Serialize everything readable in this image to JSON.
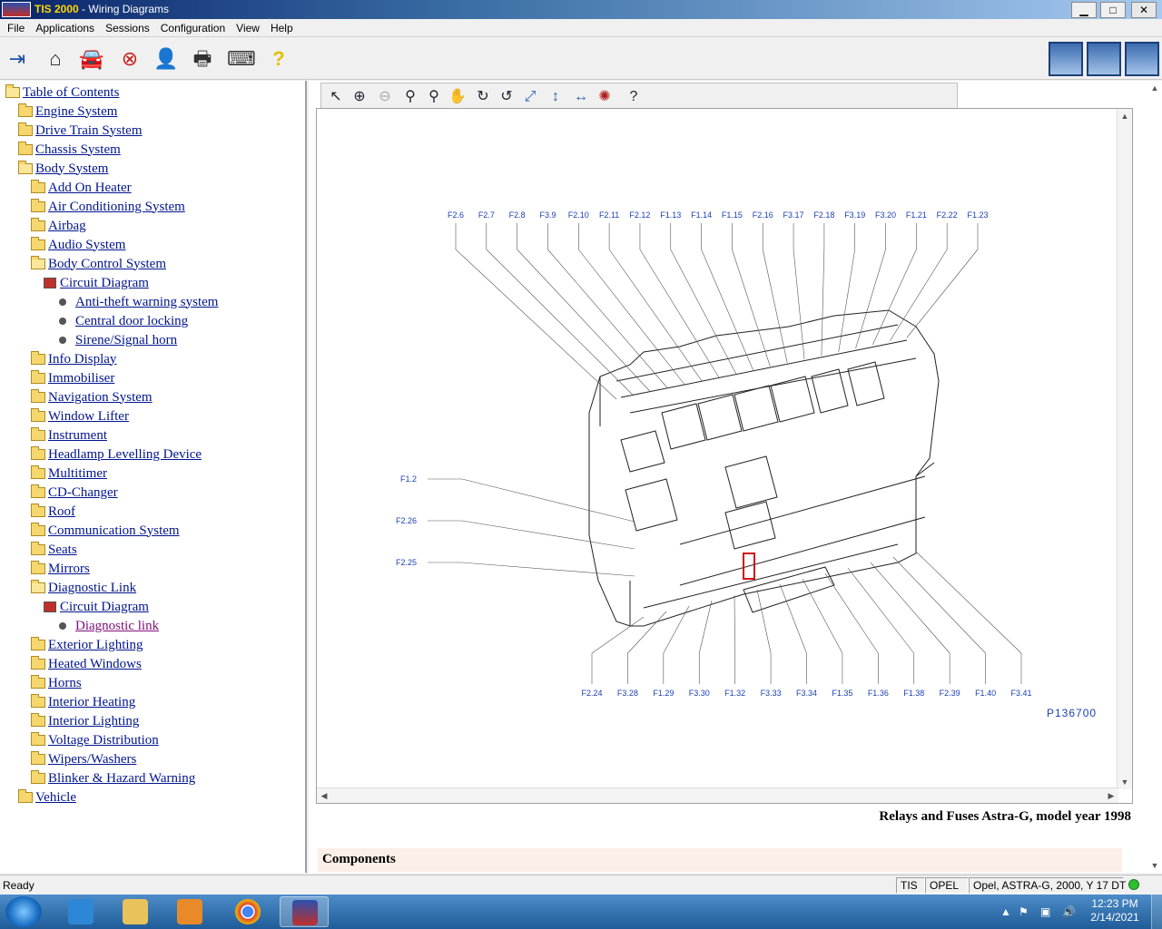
{
  "window": {
    "brand": "TIS 2000",
    "title_suffix": " - Wiring Diagrams",
    "minimize": "▁",
    "maximize": "□",
    "close": "✕"
  },
  "menu": [
    "File",
    "Applications",
    "Sessions",
    "Configuration",
    "View",
    "Help"
  ],
  "toolbar_icons": [
    "exit-icon",
    "home-icon",
    "vehicle-icon",
    "stop-icon",
    "user-icon",
    "print-icon",
    "keyboard-icon",
    "help-icon"
  ],
  "tree": [
    {
      "label": "Table of Contents",
      "depth": 0,
      "icon": "folder-open",
      "visited": false
    },
    {
      "label": "Engine System",
      "depth": 1,
      "icon": "folder",
      "visited": false
    },
    {
      "label": "Drive Train System",
      "depth": 1,
      "icon": "folder",
      "visited": false
    },
    {
      "label": "Chassis System",
      "depth": 1,
      "icon": "folder",
      "visited": false
    },
    {
      "label": "Body System",
      "depth": 1,
      "icon": "folder-open",
      "visited": false
    },
    {
      "label": "Add On Heater",
      "depth": 2,
      "icon": "folder",
      "visited": false
    },
    {
      "label": "Air Conditioning System",
      "depth": 2,
      "icon": "folder",
      "visited": false
    },
    {
      "label": "Airbag",
      "depth": 2,
      "icon": "folder",
      "visited": false
    },
    {
      "label": "Audio System",
      "depth": 2,
      "icon": "folder",
      "visited": false
    },
    {
      "label": "Body Control System",
      "depth": 2,
      "icon": "folder-open",
      "visited": false
    },
    {
      "label": "Circuit Diagram",
      "depth": 3,
      "icon": "diagram",
      "visited": false
    },
    {
      "label": "Anti-theft warning system",
      "depth": 4,
      "icon": "bullet",
      "visited": false
    },
    {
      "label": "Central door locking",
      "depth": 4,
      "icon": "bullet",
      "visited": false
    },
    {
      "label": "Sirene/Signal horn",
      "depth": 4,
      "icon": "bullet",
      "visited": false
    },
    {
      "label": "Info Display",
      "depth": 2,
      "icon": "folder",
      "visited": false
    },
    {
      "label": "Immobiliser",
      "depth": 2,
      "icon": "folder",
      "visited": false
    },
    {
      "label": "Navigation System",
      "depth": 2,
      "icon": "folder",
      "visited": false
    },
    {
      "label": "Window Lifter",
      "depth": 2,
      "icon": "folder",
      "visited": false
    },
    {
      "label": "Instrument",
      "depth": 2,
      "icon": "folder",
      "visited": false
    },
    {
      "label": "Headlamp Levelling Device",
      "depth": 2,
      "icon": "folder",
      "visited": false
    },
    {
      "label": "Multitimer",
      "depth": 2,
      "icon": "folder",
      "visited": false
    },
    {
      "label": "CD-Changer",
      "depth": 2,
      "icon": "folder",
      "visited": false
    },
    {
      "label": "Roof",
      "depth": 2,
      "icon": "folder",
      "visited": false
    },
    {
      "label": "Communication System",
      "depth": 2,
      "icon": "folder",
      "visited": false
    },
    {
      "label": "Seats",
      "depth": 2,
      "icon": "folder",
      "visited": false
    },
    {
      "label": "Mirrors",
      "depth": 2,
      "icon": "folder",
      "visited": false
    },
    {
      "label": "Diagnostic Link",
      "depth": 2,
      "icon": "folder-open",
      "visited": false
    },
    {
      "label": "Circuit Diagram",
      "depth": 3,
      "icon": "diagram",
      "visited": false
    },
    {
      "label": "Diagnostic link",
      "depth": 4,
      "icon": "bullet",
      "visited": true
    },
    {
      "label": "Exterior Lighting",
      "depth": 2,
      "icon": "folder",
      "visited": false
    },
    {
      "label": "Heated Windows",
      "depth": 2,
      "icon": "folder",
      "visited": false
    },
    {
      "label": "Horns",
      "depth": 2,
      "icon": "folder",
      "visited": false
    },
    {
      "label": "Interior Heating",
      "depth": 2,
      "icon": "folder",
      "visited": false
    },
    {
      "label": "Interior Lighting",
      "depth": 2,
      "icon": "folder",
      "visited": false
    },
    {
      "label": "Voltage Distribution",
      "depth": 2,
      "icon": "folder",
      "visited": false
    },
    {
      "label": "Wipers/Washers",
      "depth": 2,
      "icon": "folder",
      "visited": false
    },
    {
      "label": "Blinker & Hazard Warning",
      "depth": 2,
      "icon": "folder",
      "visited": false
    },
    {
      "label": "Vehicle",
      "depth": 1,
      "icon": "folder",
      "visited": false
    }
  ],
  "viewer_tools": [
    "pointer-icon",
    "zoom-in-icon",
    "zoom-out-icon",
    "zoom-icon",
    "zoom-area-icon",
    "pan-icon",
    "rotate-cw-icon",
    "rotate-ccw-icon",
    "fit-page-icon",
    "fit-height-icon",
    "fit-width-icon",
    "highlight-icon",
    "viewer-help-icon"
  ],
  "diagram": {
    "top_labels": [
      "F2.6",
      "F2.7",
      "F2.8",
      "F3.9",
      "F2.10",
      "F2.11",
      "F2.12",
      "F1.13",
      "F1.14",
      "F1.15",
      "F2.16",
      "F3.17",
      "F2.18",
      "F3.19",
      "F3.20",
      "F1.21",
      "F2.22",
      "F1.23"
    ],
    "left_labels": [
      "F1.2",
      "F2.26",
      "F2.25"
    ],
    "bottom_labels": [
      "F2.24",
      "F3.28",
      "F1.29",
      "F3.30",
      "F1.32",
      "F3.33",
      "F3.34",
      "F1.35",
      "F1.36",
      "F1.38",
      "F2.39",
      "F1.40",
      "F3.41"
    ],
    "reference": "P136700",
    "label_color": "#1a3fb5",
    "highlight_color": "#d01010"
  },
  "caption": "Relays and Fuses Astra-G, model year 1998",
  "components_header": "Components",
  "status": {
    "ready": "Ready",
    "cells": [
      "TIS",
      "OPEL",
      "Opel, ASTRA-G, 2000, Y 17 DT"
    ],
    "led_color": "#2dc02d"
  },
  "taskbar": {
    "apps": [
      "internet-explorer-icon",
      "file-explorer-icon",
      "media-player-icon",
      "chrome-icon",
      "tis2000-icon"
    ],
    "time": "12:23 PM",
    "date": "2/14/2021"
  }
}
